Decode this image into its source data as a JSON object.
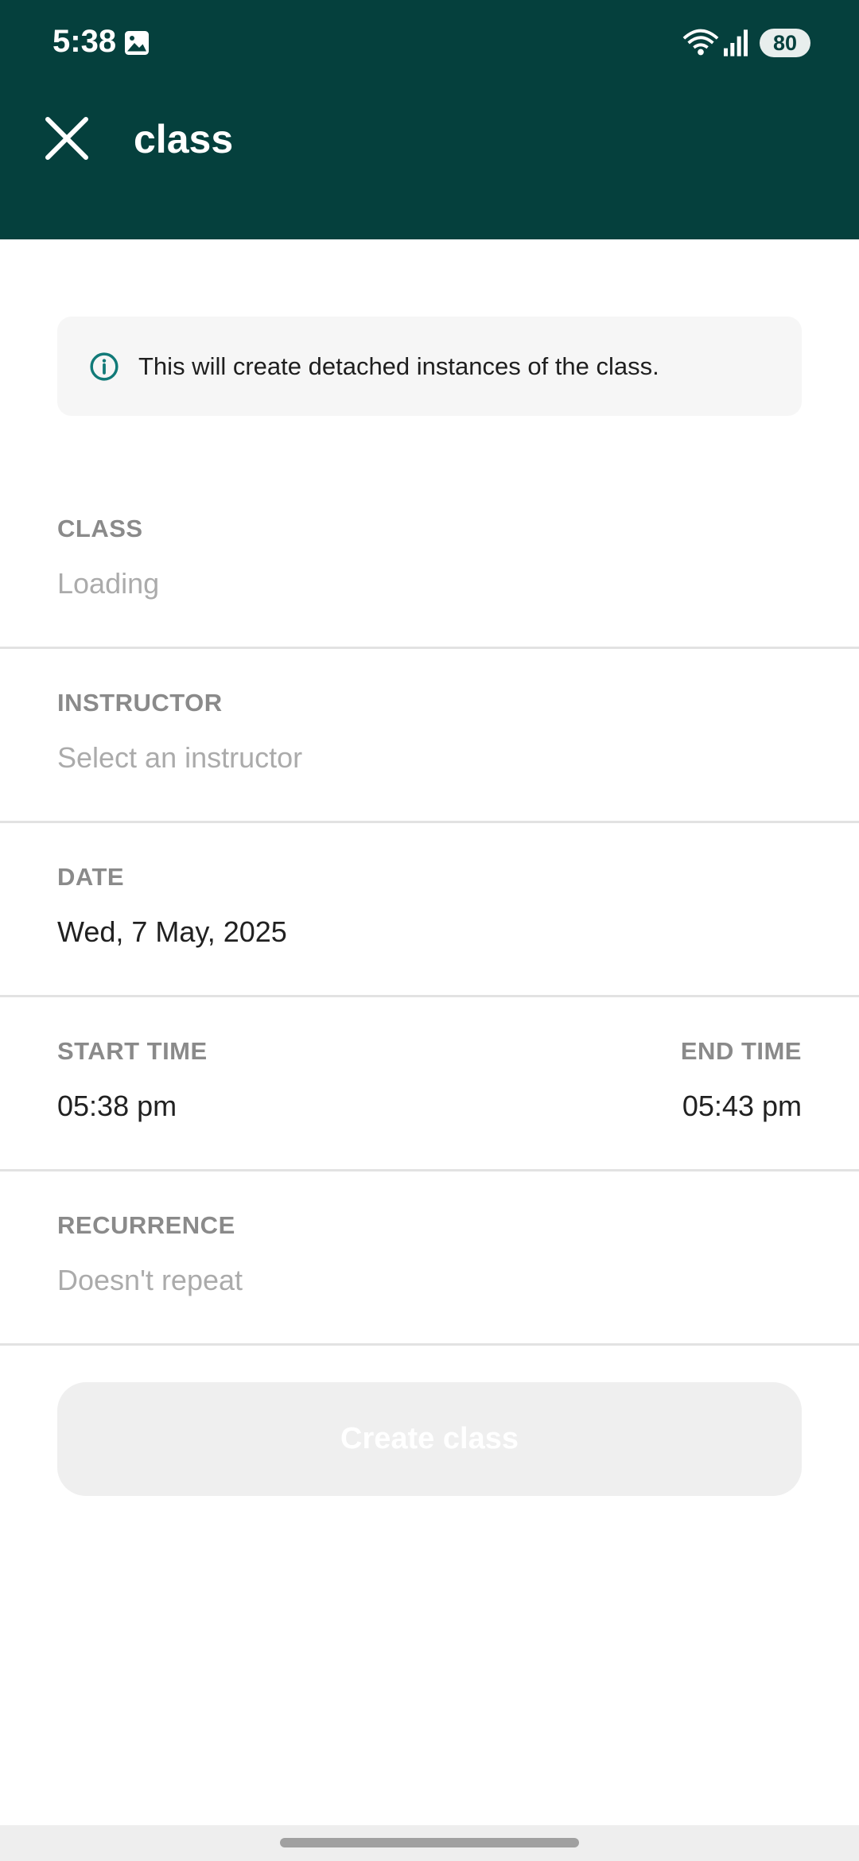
{
  "status_bar": {
    "time": "5:38",
    "battery": "80",
    "icons": [
      "gallery-icon",
      "wifi-icon",
      "signal-icon"
    ]
  },
  "header": {
    "title": "class",
    "close_icon": "close-icon",
    "background_color": "#05403d"
  },
  "info_banner": {
    "icon": "info-icon",
    "text": "This will create detached instances of the class.",
    "icon_color": "#117a78"
  },
  "form": {
    "class": {
      "label": "CLASS",
      "value": "Loading"
    },
    "instructor": {
      "label": "INSTRUCTOR",
      "placeholder": "Select an instructor"
    },
    "date": {
      "label": "DATE",
      "value": "Wed, 7 May, 2025"
    },
    "start_time": {
      "label": "START TIME",
      "value": "05:38 pm"
    },
    "end_time": {
      "label": "END TIME",
      "value": "05:43 pm"
    },
    "recurrence": {
      "label": "RECURRENCE",
      "value": "Doesn't repeat"
    }
  },
  "actions": {
    "create_label": "Create class",
    "create_enabled": false
  }
}
